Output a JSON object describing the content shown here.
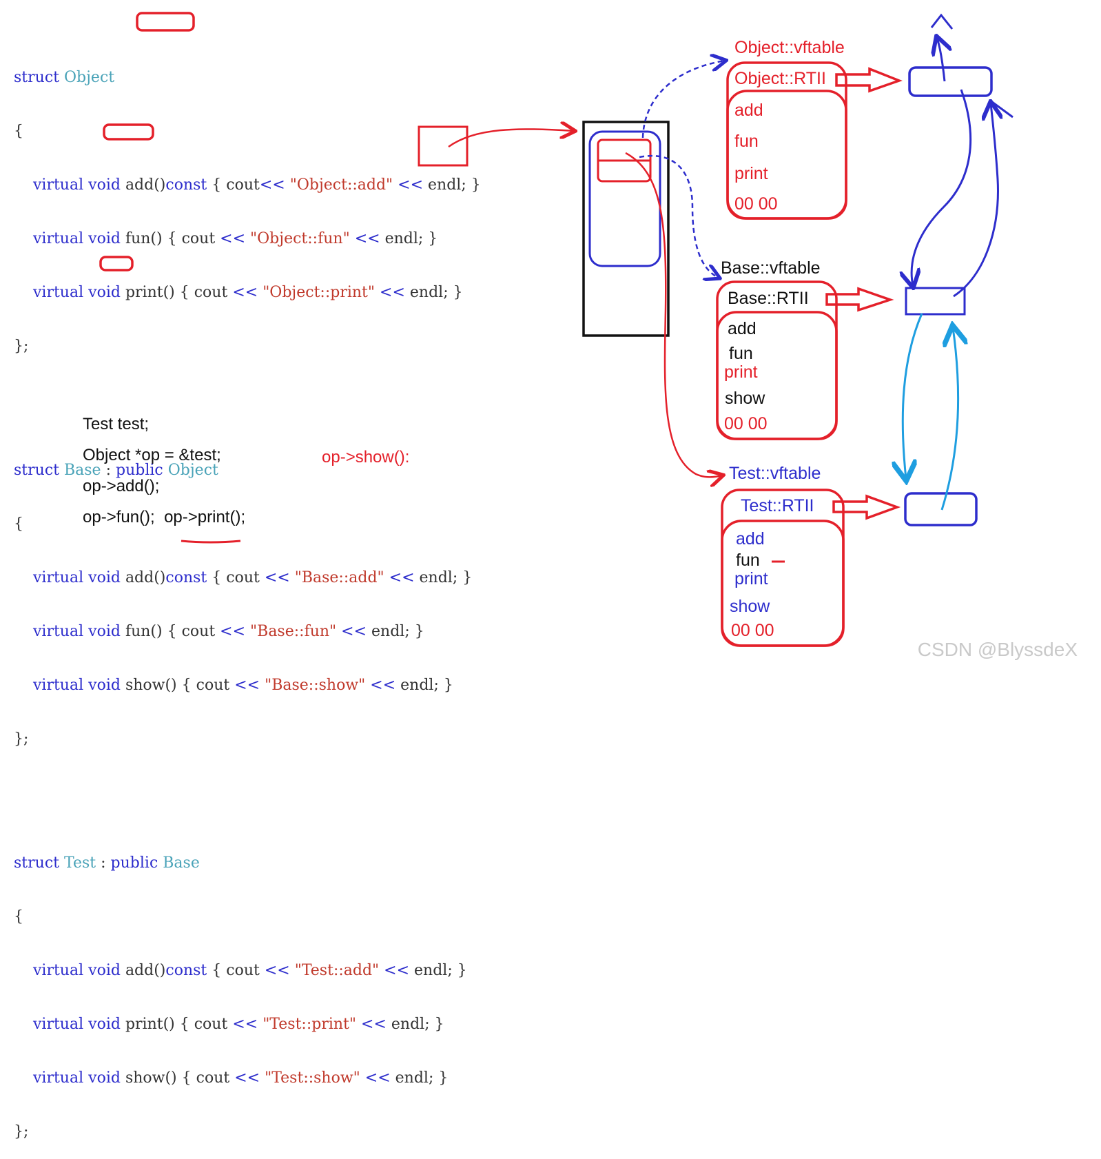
{
  "code": {
    "object": {
      "header": [
        "struct",
        "Object"
      ],
      "open": "{",
      "methods": [
        {
          "v": "virtual",
          "ret": "void",
          "sig": "add()",
          "cq": "const",
          "body1": " { cout",
          "op1": "<<",
          "str": "\"Object::add\"",
          "op2": "<<",
          "tail": " endl; }"
        },
        {
          "v": "virtual",
          "ret": "void",
          "sig": "fun()",
          "cq": "",
          "body1": " { cout ",
          "op1": "<<",
          "str": "\"Object::fun\"",
          "op2": "<<",
          "tail": " endl; }"
        },
        {
          "v": "virtual",
          "ret": "void",
          "sig": "print()",
          "cq": "",
          "body1": " { cout ",
          "op1": "<<",
          "str": "\"Object::print\"",
          "op2": "<<",
          "tail": " endl; }"
        }
      ],
      "close": "};"
    },
    "base": {
      "header": [
        "struct",
        "Base",
        ":",
        "public",
        "Object"
      ],
      "open": "{",
      "methods": [
        {
          "v": "virtual",
          "ret": "void",
          "sig": "add()",
          "cq": "const",
          "body1": " { cout ",
          "op1": "<<",
          "str": "\"Base::add\"",
          "op2": "<<",
          "tail": " endl; }"
        },
        {
          "v": "virtual",
          "ret": "void",
          "sig": "fun()",
          "cq": "",
          "body1": " { cout ",
          "op1": "<<",
          "str": "\"Base::fun\"",
          "op2": "<<",
          "tail": " endl; }"
        },
        {
          "v": "virtual",
          "ret": "void",
          "sig": "show()",
          "cq": "",
          "body1": " { cout ",
          "op1": "<<",
          "str": "\"Base::show\"",
          "op2": "<<",
          "tail": " endl; }"
        }
      ],
      "close": "};"
    },
    "test": {
      "header": [
        "struct",
        "Test",
        ":",
        "public",
        "Base"
      ],
      "open": "{",
      "methods": [
        {
          "v": "virtual",
          "ret": "void",
          "sig": "add()",
          "cq": "const",
          "body1": " { cout ",
          "op1": "<<",
          "str": "\"Test::add\"",
          "op2": "<<",
          "tail": " endl; }"
        },
        {
          "v": "virtual",
          "ret": "void",
          "sig": "print()",
          "cq": "",
          "body1": " { cout ",
          "op1": "<<",
          "str": "\"Test::print\"",
          "op2": "<<",
          "tail": " endl; }"
        },
        {
          "v": "virtual",
          "ret": "void",
          "sig": "show()",
          "cq": "",
          "body1": " { cout ",
          "op1": "<<",
          "str": "\"Test::show\"",
          "op2": "<<",
          "tail": " endl; }"
        }
      ],
      "close": "};"
    }
  },
  "snippet": {
    "l1": "Test test;",
    "l2": "Object *op = &test;",
    "l3": "op->add();",
    "l4a": "op->fun();",
    "l4b": "op->print();"
  },
  "note": "op->show():",
  "vtables": {
    "object": {
      "title": "Object::vftable",
      "rtti": "Object::RTII",
      "entries": [
        "add",
        "fun",
        "print"
      ],
      "end": "00 00"
    },
    "base": {
      "title": "Base::vftable",
      "rtti": "Base::RTII",
      "entries": [
        "add",
        "fun",
        "print",
        "show"
      ],
      "end": "00 00"
    },
    "test": {
      "title": "Test::vftable",
      "rtti": "Test::RTII",
      "entries": [
        "add",
        "fun",
        "print",
        "show"
      ],
      "end": "00 00"
    }
  },
  "watermark": "CSDN @BlyssdeX",
  "colors": {
    "red": "#e4202a",
    "blue": "#2d2dcc",
    "lightblue": "#1e9ee0",
    "black": "#111111"
  }
}
